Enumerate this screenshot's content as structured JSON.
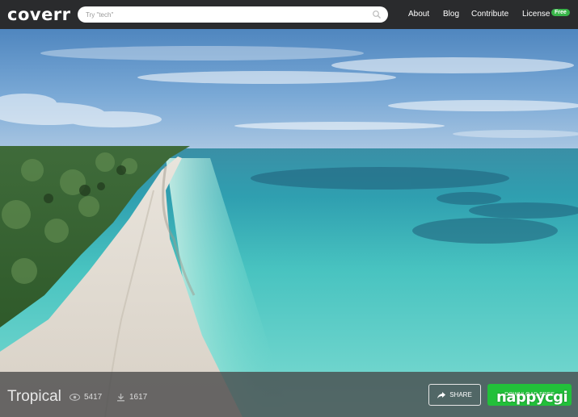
{
  "header": {
    "logo": "coverr",
    "search": {
      "placeholder": "Try \"tech\"",
      "value": ""
    },
    "nav": [
      {
        "label": "About"
      },
      {
        "label": "Blog"
      },
      {
        "label": "Contribute"
      },
      {
        "label": "License"
      }
    ],
    "license_badge": "Free"
  },
  "video": {
    "title": "Tropical",
    "views": "5417",
    "downloads": "1617",
    "share_label": "SHARE",
    "download_label": "DOWNLOAD FREE"
  },
  "watermark": "nappycgi",
  "colors": {
    "header_bg": "#2a2b2d",
    "download_green": "#22c03a",
    "badge_green": "#3ab54a",
    "sea_turquoise": "#4ec9c4",
    "sky_blue": "#6a9fd0"
  }
}
